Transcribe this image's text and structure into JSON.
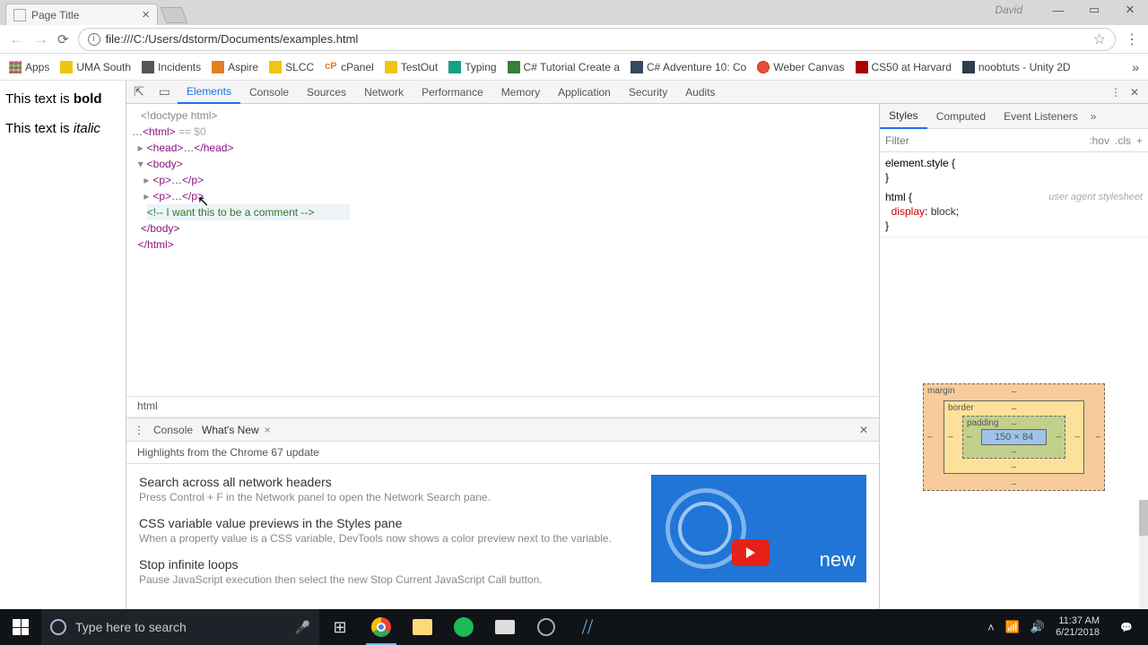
{
  "window": {
    "tab_title": "Page Title",
    "user": "David"
  },
  "address_bar": {
    "url": "file:///C:/Users/dstorm/Documents/examples.html"
  },
  "bookmarks": {
    "apps": "Apps",
    "items": [
      "UMA South",
      "Incidents",
      "Aspire",
      "SLCC",
      "cPanel",
      "TestOut",
      "Typing",
      "C# Tutorial Create a",
      "C# Adventure 10: Co",
      "Weber Canvas",
      "CS50 at Harvard",
      "noobtuts - Unity 2D"
    ]
  },
  "page": {
    "p1_prefix": "This text is ",
    "p1_bold": "bold",
    "p2_prefix": "This text is ",
    "p2_italic": "italic"
  },
  "devtools": {
    "tabs": [
      "Elements",
      "Console",
      "Sources",
      "Network",
      "Performance",
      "Memory",
      "Application",
      "Security",
      "Audits"
    ],
    "dom": {
      "doctype": "<!doctype html>",
      "html_open": "<html>",
      "eq0": " == $0",
      "head": "<head>…</head>",
      "body_open": "<body>",
      "p1": "<p>…</p>",
      "p2": "<p>…</p>",
      "comment": "<!-- I want this to be a comment -->",
      "body_close": "</body>",
      "html_close": "</html>"
    },
    "crumb": "html",
    "styles": {
      "tabs": [
        "Styles",
        "Computed",
        "Event Listeners"
      ],
      "filter_placeholder": "Filter",
      "hov": ":hov",
      "cls": ".cls",
      "rule1": "element.style {",
      "rule1_close": "}",
      "rule2_sel": "html {",
      "rule2_ua": "user agent stylesheet",
      "rule2_prop": "display",
      "rule2_val": "block",
      "rule2_close": "}",
      "box": {
        "margin": "margin",
        "border": "border",
        "padding": "padding",
        "content": "150 × 84",
        "dash": "–"
      }
    },
    "drawer": {
      "tabs": [
        "Console",
        "What's New"
      ],
      "subtitle": "Highlights from the Chrome 67 update",
      "items": [
        {
          "title": "Search across all network headers",
          "desc": "Press Control + F in the Network panel to open the Network Search pane."
        },
        {
          "title": "CSS variable value previews in the Styles pane",
          "desc": "When a property value is a CSS variable, DevTools now shows a color preview next to the variable."
        },
        {
          "title": "Stop infinite loops",
          "desc": "Pause JavaScript execution then select the new Stop Current JavaScript Call button."
        }
      ],
      "video_text": "new"
    }
  },
  "taskbar": {
    "search_placeholder": "Type here to search",
    "time": "11:37 AM",
    "date": "6/21/2018"
  }
}
